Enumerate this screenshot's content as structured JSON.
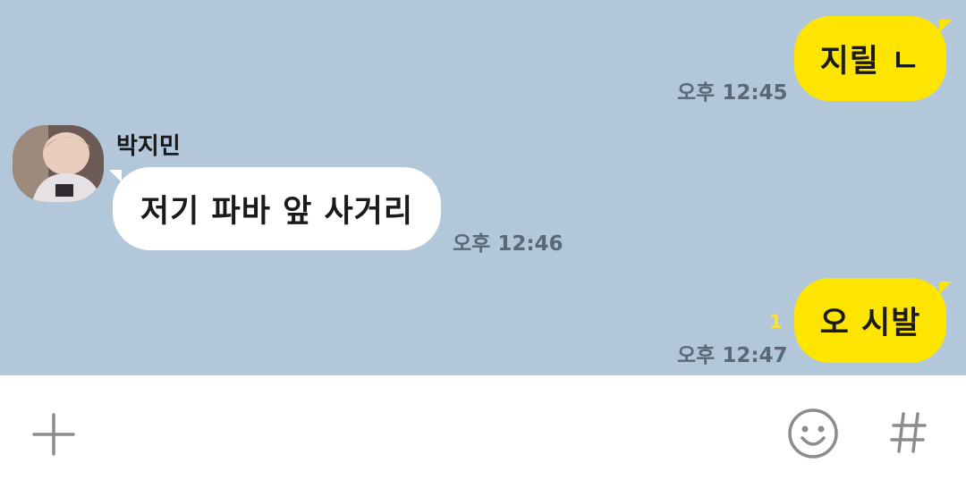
{
  "chat": {
    "messages": [
      {
        "direction": "sent",
        "text": "지릴 ㄴ",
        "time": "오후 12:45",
        "unread": ""
      },
      {
        "direction": "received",
        "sender": "박지민",
        "text": "저기 파바 앞 사거리",
        "time": "오후 12:46"
      },
      {
        "direction": "sent",
        "text": "오 시발",
        "time": "오후 12:47",
        "unread": "1"
      }
    ]
  },
  "input": {
    "placeholder": "",
    "icons": [
      "plus-icon",
      "emoji-icon",
      "hash-icon"
    ]
  },
  "colors": {
    "background": "#b2c7da",
    "sent_bubble": "#fee500",
    "received_bubble": "#ffffff",
    "time_text": "#5b6876",
    "unread_count": "#f6e23b"
  }
}
